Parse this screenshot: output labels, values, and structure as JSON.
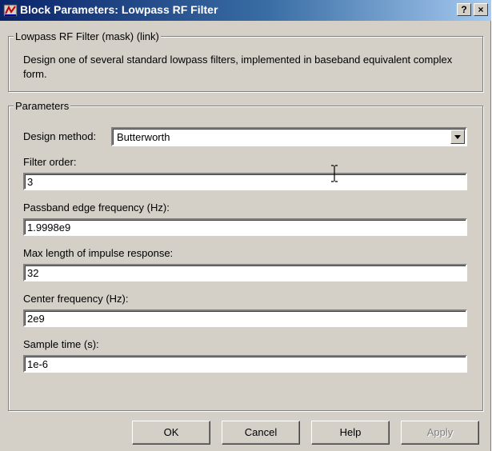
{
  "window": {
    "title": "Block Parameters: Lowpass RF Filter",
    "help_button": "?",
    "close_button": "×"
  },
  "mask_group": {
    "label": "Lowpass RF Filter (mask) (link)",
    "description": "Design one of several standard lowpass filters, implemented in baseband equivalent complex form."
  },
  "parameters": {
    "label": "Parameters",
    "design_method": {
      "label": "Design method:",
      "value": "Butterworth"
    },
    "filter_order": {
      "label": "Filter order:",
      "value": "3"
    },
    "passband_edge": {
      "label": "Passband edge frequency (Hz):",
      "value": "1.9998e9"
    },
    "max_length": {
      "label": "Max length of impulse response:",
      "value": "32"
    },
    "center_freq": {
      "label": "Center frequency (Hz):",
      "value": "2e9"
    },
    "sample_time": {
      "label": "Sample time (s):",
      "value": "1e-6"
    }
  },
  "buttons": {
    "ok": "OK",
    "cancel": "Cancel",
    "help": "Help",
    "apply": "Apply"
  },
  "icons": {
    "app": "simulink-block-icon",
    "dropdown": "dropdown-arrow-icon",
    "cursor": "text-cursor-icon"
  },
  "colors": {
    "titlebar_start": "#0a246a",
    "titlebar_end": "#a6caf0",
    "dialog_bg": "#d4d0c8"
  }
}
